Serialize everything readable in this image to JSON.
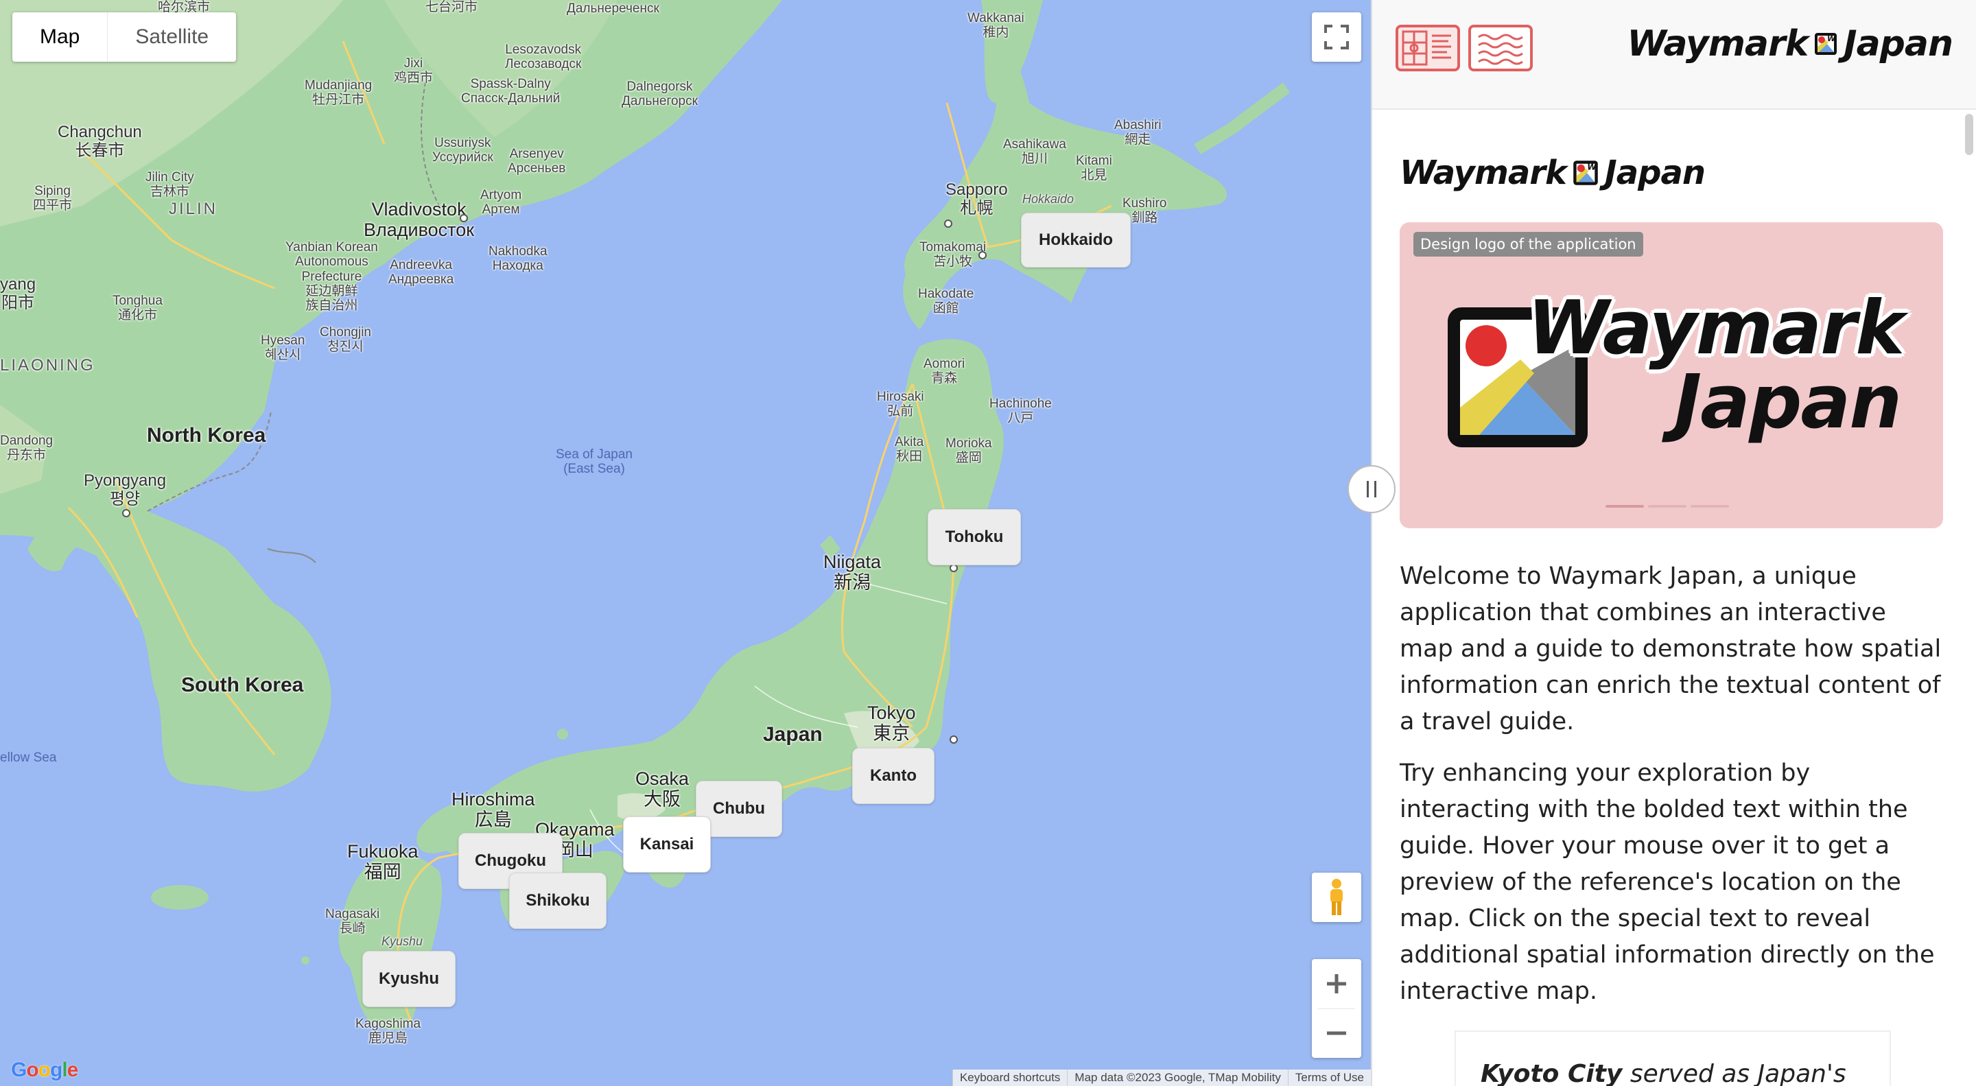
{
  "map": {
    "type_controls": {
      "map": "Map",
      "satellite": "Satellite"
    },
    "labels": {
      "changchun": "Changchun\n长春市",
      "jilin_city": "Jilin City\n吉林市",
      "jilin": "JILIN",
      "siping": "Siping\n四平市",
      "tonghua": "Tonghua\n通化市",
      "yanbian": "Yanbian Korean\nAutonomous\nPrefecture\n延边朝鲜\n族自治州",
      "hyesan": "Hyesan\n혜산시",
      "chongjin": "Chongjin\n청진시",
      "liaoning": "LIAONING",
      "dandong": "Dandong\n丹东市",
      "yang": "yang\n阳市",
      "north_korea": "North Korea",
      "pyongyang": "Pyongyang\n평양",
      "south_korea": "South Korea",
      "yellow_sea": "ellow Sea",
      "vladivostok": "Vladivostok\nВладивосток",
      "andreevka": "Andreevka\nАндреевка",
      "nakhodka": "Nakhodka\nНаходка",
      "artyom": "Artyom\nАртем",
      "ussuriysk": "Ussuriysk\nУссурийск",
      "arsenyev": "Arsenyev\nАрсеньев",
      "spassk": "Spassk-Dalny\nСпасск-Дальний",
      "lesozavodsk": "Lesozavodsk\nЛесозаводск",
      "dalnegorsk": "Dalnegorsk\nДальнегорск",
      "dalnerechensk": "Дальнереченск",
      "mudanjiang": "Mudanjiang\n牡丹江市",
      "jixi": "Jixi\n鸡西市",
      "qitaihe": "七台河市",
      "harbin": "哈尔滨市",
      "sea_of_japan": "Sea of Japan\n(East Sea)",
      "wakkanai": "Wakkanai\n稚内",
      "asahikawa": "Asahikawa\n旭川",
      "abashiri": "Abashiri\n網走",
      "kitami": "Kitami\n北見",
      "sapporo": "Sapporo\n札幌",
      "hokkaido_it": "Hokkaido",
      "kushiro": "Kushiro\n釧路",
      "tomakomai": "Tomakomai\n苫小牧",
      "hakodate": "Hakodate\n函館",
      "aomori": "Aomori\n青森",
      "hirosaki": "Hirosaki\n弘前",
      "hachinohe": "Hachinohe\n八戸",
      "akita": "Akita\n秋田",
      "morioka": "Morioka\n盛岡",
      "niigata": "Niigata\n新潟",
      "japan": "Japan",
      "tokyo": "Tokyo\n東京",
      "osaka": "Osaka\n大阪",
      "okayama": "Okayama\n岡山",
      "hiroshima": "Hiroshima\n広島",
      "fukuoka": "Fukuoka\n福岡",
      "nagasaki": "Nagasaki\n長崎",
      "kyushu_it": "Kyushu",
      "kagoshima": "Kagoshima\n鹿児島"
    },
    "regions": {
      "hokkaido": "Hokkaido",
      "tohoku": "Tohoku",
      "kanto": "Kanto",
      "chubu": "Chubu",
      "kansai": "Kansai",
      "chugoku": "Chugoku",
      "shikoku": "Shikoku",
      "kyushu": "Kyushu"
    },
    "attribution": {
      "shortcuts": "Keyboard shortcuts",
      "data": "Map data ©2023 Google, TMap Mobility",
      "terms": "Terms of Use"
    },
    "google_logo": "Google",
    "colors": {
      "water": "#9bb9f2",
      "land": "#a8d5a6",
      "land_light": "#dfe8d4",
      "road": "#f6d36c"
    }
  },
  "panel": {
    "brand": {
      "word1": "Waymark",
      "word2": "Japan"
    },
    "title": {
      "word1": "Waymark",
      "word2": "Japan"
    },
    "figure": {
      "caption": "Design logo of the application",
      "word1": "Waymark",
      "word2": "Japan",
      "background": "#f2c9cb"
    },
    "paragraphs": [
      "Welcome to Waymark Japan, a unique application that combines an interactive map and a guide to demonstrate how spatial information can enrich the textual content of a travel guide.",
      "Try enhancing your exploration by interacting with the bolded text within the guide. Hover your mouse over it to get a preview of the reference's location on the map. Click on the special text to reveal additional spatial information directly on the interactive map."
    ],
    "quote": {
      "bold": "Kyoto City",
      "rest": " served as Japan's"
    },
    "accent": "#e06060"
  }
}
